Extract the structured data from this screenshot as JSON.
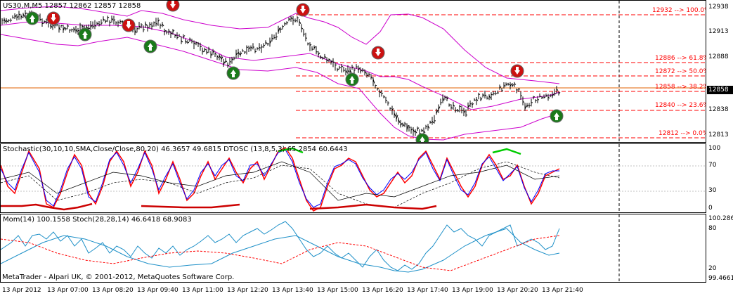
{
  "main": {
    "header": "US30,M,M5  12857 12862 12857 12858",
    "price_labels": [
      "12938",
      "12913",
      "12888",
      "12863",
      "12838",
      "12813"
    ],
    "current_price": "12858",
    "fib_levels": [
      {
        "label": "12932 --> 100.0%"
      },
      {
        "label": "12886 --> 61.8%"
      },
      {
        "label": "12872 --> 50.0%"
      },
      {
        "label": "12858 --> 38.2%"
      },
      {
        "label": "12840 --> 23.6%"
      },
      {
        "label": "12812 --> 0.0%"
      }
    ]
  },
  "stoch_pane": {
    "header": "Stochastic(30,10,10,SMA,Close/Close,80,20) 46.3657 49.6815  DTOSC (13,8,5,3) 65.2854 60.6443",
    "levels": [
      "100",
      "70",
      "30",
      "0"
    ]
  },
  "mom_pane": {
    "header": "Mom(14) 100.1558  Stoch(28,28,14) 46.6418 68.9083",
    "levels": [
      "100.2866",
      "80",
      "20",
      "99.4661"
    ]
  },
  "footer": {
    "copyright": "MetaTrader - Alpari UK, © 2001-2012, MetaQuotes Software Corp.",
    "time_labels": [
      "13 Apr 2012",
      "13 Apr 07:00",
      "13 Apr 08:20",
      "13 Apr 09:40",
      "13 Apr 11:00",
      "13 Apr 12:20",
      "13 Apr 13:40",
      "13 Apr 15:00",
      "13 Apr 16:20",
      "13 Apr 17:40",
      "13 Apr 19:00",
      "13 Apr 20:20",
      "13 Apr 21:40"
    ]
  },
  "colors": {
    "bollinger": "#cc00cc",
    "fib": "#ff0000",
    "stoch_main": "#0000ff",
    "stoch_signal": "#ff0000",
    "dtosc_highlight": "#00cc00",
    "mom_line": "#1e90c8",
    "stoch_slow": "#ff0000"
  }
}
